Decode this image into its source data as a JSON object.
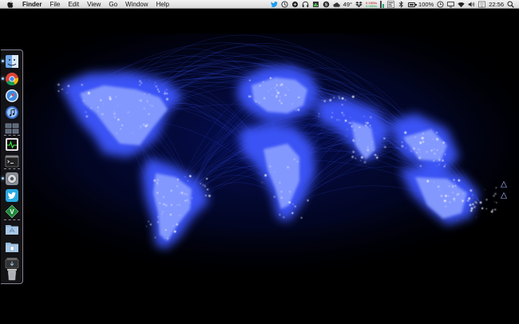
{
  "menubar": {
    "app_name": "Finder",
    "menus": [
      "File",
      "Edit",
      "View",
      "Go",
      "Window",
      "Help"
    ],
    "status": {
      "temperature": "49°",
      "net_up": "0.1KB/s",
      "net_down": "0.0KB/s",
      "battery": "100%",
      "battery_level": 1.0,
      "clock": "22:56"
    }
  },
  "dock": {
    "items": [
      {
        "name": "Finder",
        "icon": "finder-icon",
        "running": true
      },
      {
        "name": "Google Chrome",
        "icon": "chrome-icon",
        "running": true
      },
      {
        "name": "Safari",
        "icon": "safari-icon",
        "running": false
      },
      {
        "name": "iTunes",
        "icon": "itunes-icon",
        "running": false
      },
      {
        "name": "Spaces",
        "icon": "spaces-icon",
        "running": false
      },
      {
        "name": "Activity Monitor",
        "icon": "activity-monitor-icon",
        "running": false
      },
      {
        "name": "Terminal",
        "icon": "terminal-icon",
        "running": false
      },
      {
        "name": "System Preferences",
        "icon": "system-preferences-icon",
        "running": true
      },
      {
        "name": "Twitter",
        "icon": "twitter-icon",
        "running": false
      },
      {
        "name": "Vim",
        "icon": "vim-icon",
        "running": false
      },
      {
        "name": "Applications",
        "icon": "applications-folder-icon",
        "running": false
      },
      {
        "name": "Documents",
        "icon": "documents-folder-icon",
        "running": false
      },
      {
        "name": "Downloads",
        "icon": "downloads-stack-icon",
        "running": false
      },
      {
        "name": "Trash",
        "icon": "trash-icon",
        "running": false
      }
    ]
  },
  "wallpaper": {
    "subject": "world-network-map",
    "glow_color": "#4d6bff",
    "highlight_color": "#dfe6ff"
  }
}
